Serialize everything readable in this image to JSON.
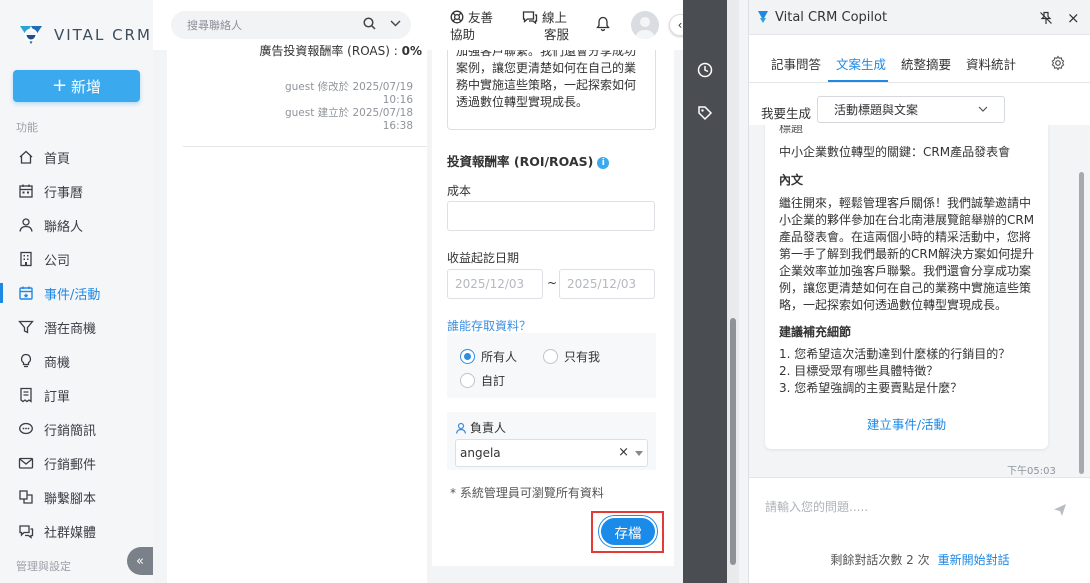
{
  "brand": {
    "name": "VITAL CRM",
    "color": "#1e88e5"
  },
  "sidebar": {
    "add_label": "新增",
    "section_function": "功能",
    "section_admin": "管理與設定",
    "items": [
      {
        "label": "首頁",
        "icon": "home-icon"
      },
      {
        "label": "行事曆",
        "icon": "calendar-icon"
      },
      {
        "label": "聯絡人",
        "icon": "user-icon"
      },
      {
        "label": "公司",
        "icon": "building-icon"
      },
      {
        "label": "事件/活動",
        "icon": "calendar-event-icon",
        "active": true
      },
      {
        "label": "潛在商機",
        "icon": "funnel-icon"
      },
      {
        "label": "商機",
        "icon": "lightbulb-icon"
      },
      {
        "label": "訂單",
        "icon": "receipt-icon"
      },
      {
        "label": "行銷簡訊",
        "icon": "chat-icon"
      },
      {
        "label": "行銷郵件",
        "icon": "mail-icon"
      },
      {
        "label": "聯繫腳本",
        "icon": "script-icon"
      },
      {
        "label": "社群媒體",
        "icon": "social-icon"
      }
    ]
  },
  "topbar": {
    "search_placeholder": "搜尋聯絡人",
    "friendly_line1": "友善",
    "friendly_line2": "協助",
    "support_line1": "線上",
    "support_line2": "客服"
  },
  "record": {
    "roas_label": "廣告投資報酬率 (ROAS) :",
    "roas_value": "0%",
    "modified_by": "guest 修改於 2025/07/19",
    "modified_time": "10:16",
    "created_by": "guest 建立於 2025/07/18",
    "created_time": "16:38"
  },
  "form": {
    "description_tail": [
      "加強客戶聯繫。我們還會分享成功",
      "案例，讓您更清楚如何在自己的業",
      "務中實施這些策略，一起探索如何",
      "透過數位轉型實現成長。"
    ],
    "roi_title": "投資報酬率 (ROI/ROAS)",
    "cost_label": "成本",
    "cost_value": "",
    "revenue_date_label": "收益起訖日期",
    "date_start": "2025/12/03",
    "date_separator": "~",
    "date_end": "2025/12/03",
    "access_title": "誰能存取資料？",
    "access_options": [
      {
        "label": "所有人",
        "selected": true
      },
      {
        "label": "只有我",
        "selected": false
      },
      {
        "label": "自訂",
        "selected": false
      }
    ],
    "owner_label": "負責人",
    "owner_value": "angela",
    "owner_clear": "×",
    "sys_note": "* 系統管理員可瀏覽所有資料",
    "save_label": "存檔"
  },
  "copilot": {
    "title": "Vital CRM Copilot",
    "close": "×",
    "tabs": [
      "記事問答",
      "文案生成",
      "統整摘要",
      "資料統計"
    ],
    "active_tab": "文案生成",
    "generate_label": "我要生成",
    "generate_value": "活動標題與文案",
    "message": {
      "title_label": "標題",
      "title_text": "中小企業數位轉型的關鍵：CRM產品發表會",
      "body_label": "內文",
      "body_lines": [
        "繼往開來，輕鬆管理客戶關係！我們誠摯邀請中",
        "小企業的夥伴參加在台北南港展覽館舉辦的CRM",
        "產品發表會。在這兩個小時的精采活動中，您將",
        "第一手了解到我們最新的CRM解決方案如何提升",
        "企業效率並加強客戶聯繫。我們還會分享成功案",
        "例，讓您更清楚如何在自己的業務中實施這些策",
        "略，一起探索如何透過數位轉型實現成長。"
      ],
      "suggest_label": "建議補充細節",
      "suggestions": [
        "1. 您希望這次活動達到什麼樣的行銷目的？",
        "2. 目標受眾有哪些具體特徵？",
        "3. 您希望強調的主要賣點是什麼？"
      ],
      "create_link": "建立事件/活動",
      "time": "下午05:03"
    },
    "input_placeholder": "請輸入您的問題.....",
    "remaining": "剩餘對話次數 2 次",
    "restart": "重新開始對話"
  }
}
